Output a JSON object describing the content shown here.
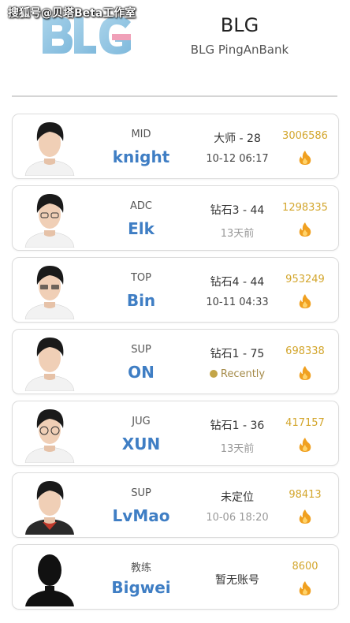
{
  "watermark": "搜狐号@贝塔Beta工作室",
  "header": {
    "logo_text": "BLG",
    "team_name": "BLG",
    "team_sub": "BLG PingAnBank"
  },
  "players": [
    {
      "role": "MID",
      "name": "knight",
      "rank": "大师 - 28",
      "time": "10-12 06:17",
      "score": "3006586",
      "time_style": "normal"
    },
    {
      "role": "ADC",
      "name": "Elk",
      "rank": "钻石3 - 44",
      "time": "13天前",
      "score": "1298335",
      "time_style": "muted"
    },
    {
      "role": "TOP",
      "name": "Bin",
      "rank": "钻石4 - 44",
      "time": "10-11 04:33",
      "score": "953249",
      "time_style": "normal"
    },
    {
      "role": "SUP",
      "name": "ON",
      "rank": "钻石1 - 75",
      "time": "Recently",
      "score": "698338",
      "time_style": "recent"
    },
    {
      "role": "JUG",
      "name": "XUN",
      "rank": "钻石1 - 36",
      "time": "13天前",
      "score": "417157",
      "time_style": "muted"
    },
    {
      "role": "SUP",
      "name": "LvMao",
      "rank": "未定位",
      "time": "10-06 18:20",
      "score": "98413",
      "time_style": "muted"
    },
    {
      "role": "教练",
      "name": "Bigwei",
      "rank": "暂无账号",
      "time": "",
      "score": "8600",
      "time_style": "none"
    }
  ],
  "colors": {
    "name_blue": "#3f7ec4",
    "score_gold": "#d3a62d",
    "flame_orange": "#f0a020",
    "logo_blue": "#8fc6e2",
    "logo_pink": "#f0a0b8"
  },
  "icons": {
    "flame": "flame-icon",
    "status_dot": "status-dot-icon"
  }
}
